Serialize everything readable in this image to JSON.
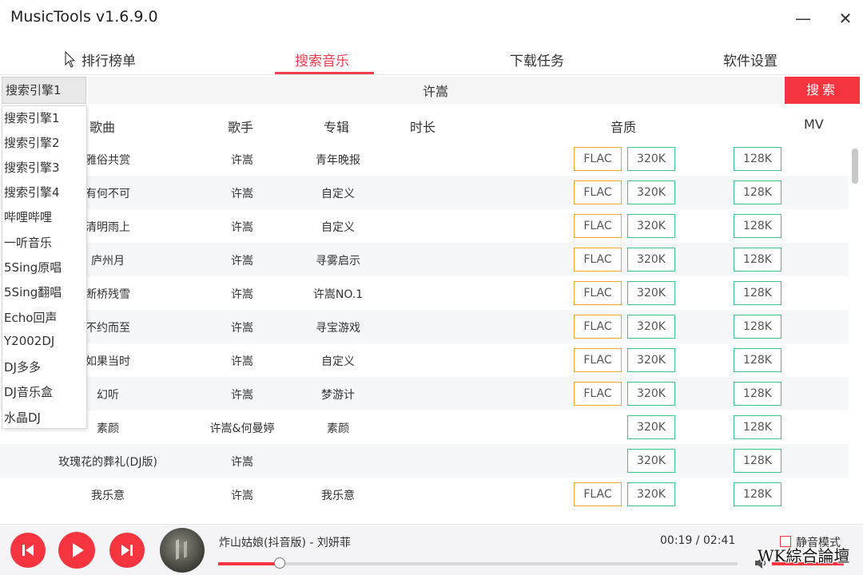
{
  "window": {
    "title": "MusicTools v1.6.9.0",
    "minimize_glyph": "—",
    "close_glyph": "✕"
  },
  "tabs": [
    {
      "label": "排行榜单"
    },
    {
      "label": "搜索音乐"
    },
    {
      "label": "下载任务"
    },
    {
      "label": "软件设置"
    }
  ],
  "search": {
    "engine": "搜索引擎1",
    "query": "许嵩",
    "button": "搜索"
  },
  "engines": [
    "搜索引擎1",
    "搜索引擎2",
    "搜索引擎3",
    "搜索引擎4",
    "哔哩哔哩",
    "一听音乐",
    "5Sing原唱",
    "5Sing翻唱",
    "Echo回声",
    "Y2002DJ",
    "DJ多多",
    "DJ音乐盒",
    "水晶DJ"
  ],
  "columns": {
    "song": "歌曲",
    "artist": "歌手",
    "album": "专辑",
    "duration": "时长",
    "quality": "音质",
    "mv": "MV"
  },
  "songs": [
    {
      "title": "雅俗共赏",
      "artist": "许嵩",
      "album": "青年晚报",
      "flac": "FLAC",
      "q320": "320K",
      "q128": "128K"
    },
    {
      "title": "有何不可",
      "artist": "许嵩",
      "album": "自定义",
      "flac": "FLAC",
      "q320": "320K",
      "q128": "128K"
    },
    {
      "title": "清明雨上",
      "artist": "许嵩",
      "album": "自定义",
      "flac": "FLAC",
      "q320": "320K",
      "q128": "128K"
    },
    {
      "title": "庐州月",
      "artist": "许嵩",
      "album": "寻雾启示",
      "flac": "FLAC",
      "q320": "320K",
      "q128": "128K"
    },
    {
      "title": "断桥残雪",
      "artist": "许嵩",
      "album": "许嵩NO.1",
      "flac": "FLAC",
      "q320": "320K",
      "q128": "128K"
    },
    {
      "title": "不约而至",
      "artist": "许嵩",
      "album": "寻宝游戏",
      "flac": "FLAC",
      "q320": "320K",
      "q128": "128K"
    },
    {
      "title": "如果当时",
      "artist": "许嵩",
      "album": "自定义",
      "flac": "FLAC",
      "q320": "320K",
      "q128": "128K"
    },
    {
      "title": "幻听",
      "artist": "许嵩",
      "album": "梦游计",
      "flac": "FLAC",
      "q320": "320K",
      "q128": "128K"
    },
    {
      "title": "素颜",
      "artist": "许嵩&何曼婷",
      "album": "素颜",
      "flac": "",
      "q320": "320K",
      "q128": "128K"
    },
    {
      "title": "玫瑰花的葬礼(DJ版)",
      "artist": "许嵩",
      "album": "",
      "flac": "",
      "q320": "320K",
      "q128": "128K"
    },
    {
      "title": "我乐意",
      "artist": "许嵩",
      "album": "我乐意",
      "flac": "FLAC",
      "q320": "320K",
      "q128": "128K"
    }
  ],
  "player": {
    "track": "炸山姑娘(抖音版) - 刘妍菲",
    "time": "00:19 / 02:41",
    "progress": 0.118,
    "mute_label": "静音模式"
  },
  "watermark": "WK綜合論壇",
  "colors": {
    "accent": "#f4343f",
    "flac_border": "#f5a623",
    "quality_border": "#3cc68a"
  }
}
